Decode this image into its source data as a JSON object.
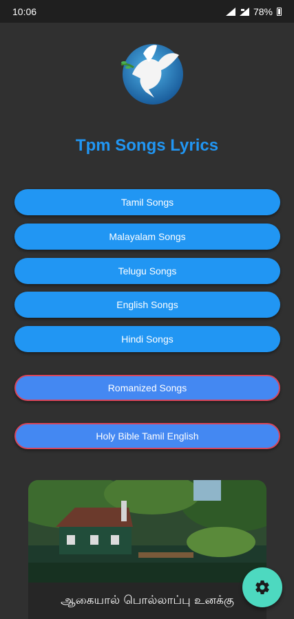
{
  "status_bar": {
    "time": "10:06",
    "battery": "78%"
  },
  "app": {
    "title": "Tpm Songs Lyrics"
  },
  "menu": {
    "tamil": "Tamil Songs",
    "malayalam": "Malayalam Songs",
    "telugu": "Telugu Songs",
    "english": "English Songs",
    "hindi": "Hindi Songs",
    "romanized": "Romanized Songs",
    "bible": "Holy Bible Tamil English"
  },
  "banner": {
    "text": "ஆகையால் பொல்லாப்பு உனக்கு"
  },
  "colors": {
    "accent": "#2196f3",
    "fab": "#4dd9c0",
    "background": "#303030"
  },
  "icons": {
    "fab": "gear-icon",
    "logo": "dove-logo"
  }
}
